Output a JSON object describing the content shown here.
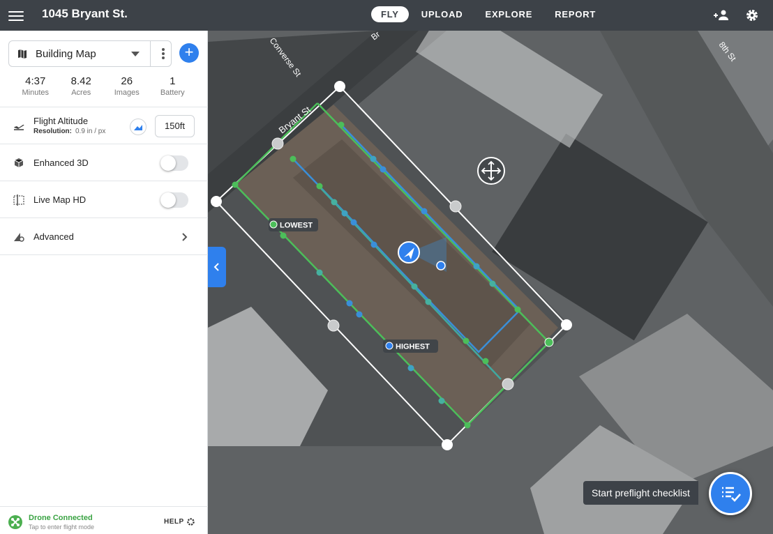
{
  "header": {
    "title": "1045 Bryant St.",
    "tabs": [
      {
        "label": "FLY",
        "active": true
      },
      {
        "label": "UPLOAD",
        "active": false
      },
      {
        "label": "EXPLORE",
        "active": false
      },
      {
        "label": "REPORT",
        "active": false
      }
    ],
    "icons": [
      "menu-icon",
      "add-person-icon",
      "gear-icon"
    ]
  },
  "sidebar": {
    "map_type": "Building Map",
    "stats": [
      {
        "value": "4:37",
        "label": "Minutes"
      },
      {
        "value": "8.42",
        "label": "Acres"
      },
      {
        "value": "26",
        "label": "Images"
      },
      {
        "value": "1",
        "label": "Battery"
      }
    ],
    "flight_altitude": {
      "label": "Flight Altitude",
      "resolution_label": "Resolution:",
      "resolution_value": "0.9 in / px",
      "value": "150ft"
    },
    "enhanced_3d": {
      "label": "Enhanced 3D",
      "enabled": false
    },
    "live_map_hd": {
      "label": "Live Map HD",
      "enabled": false
    },
    "advanced": {
      "label": "Advanced"
    },
    "status": {
      "title": "Drone Connected",
      "subtitle": "Tap to enter flight mode",
      "help": "HELP"
    }
  },
  "map": {
    "streets": [
      "Bryant St",
      "Converse St",
      "8th St",
      "Br"
    ],
    "markers": {
      "lowest": "LOWEST",
      "highest": "HIGHEST"
    },
    "colors": {
      "flight_path_outer": "#4cbe5a",
      "flight_path_inner": "#3a8fd9",
      "boundary": "#ffffff",
      "accent": "#2f80ed"
    }
  },
  "preflight": {
    "label": "Start preflight checklist"
  }
}
